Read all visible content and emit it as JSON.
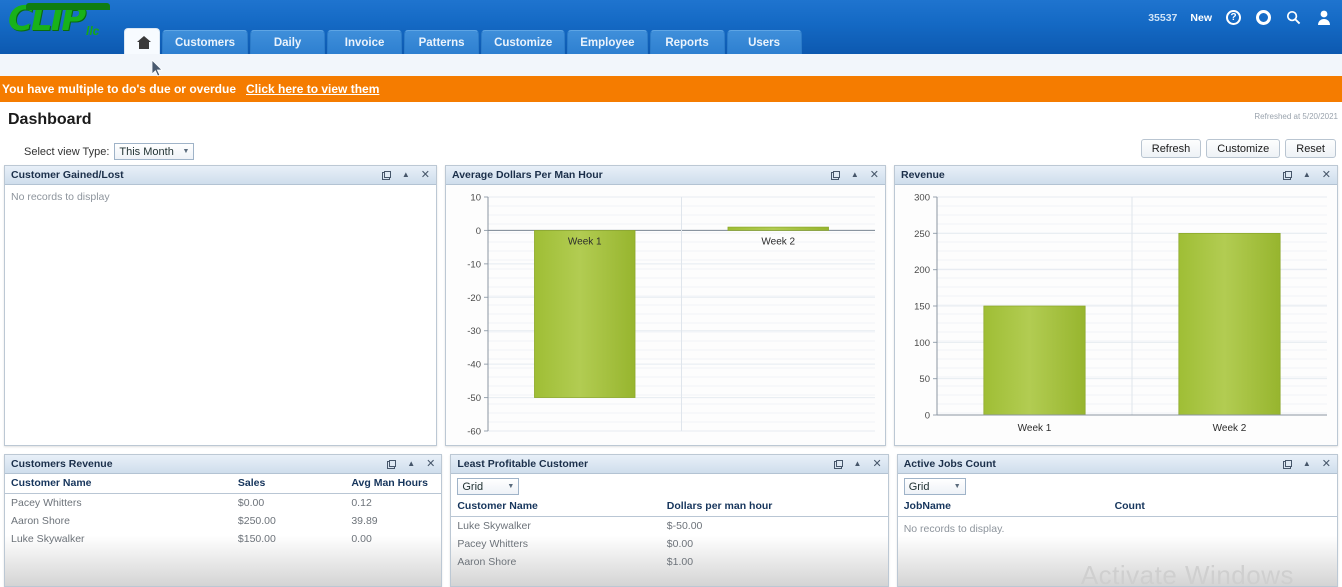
{
  "topbar": {
    "logo_text": "CLIP",
    "logo_sub": "llc",
    "tabs": [
      {
        "label": "",
        "name": "home",
        "icon": "home-icon",
        "active": true
      },
      {
        "label": "Customers",
        "name": "customers"
      },
      {
        "label": "Daily",
        "name": "daily"
      },
      {
        "label": "Invoice",
        "name": "invoice"
      },
      {
        "label": "Patterns",
        "name": "patterns"
      },
      {
        "label": "Customize",
        "name": "customize"
      },
      {
        "label": "Employee",
        "name": "employee"
      },
      {
        "label": "Reports",
        "name": "reports"
      },
      {
        "label": "Users",
        "name": "users"
      }
    ],
    "account_number": "35537",
    "new_label": "New",
    "icons": [
      "help-icon",
      "settings-icon",
      "search-icon",
      "user-icon"
    ]
  },
  "alert": {
    "message": "You have multiple to do's due or overdue",
    "link": "Click here to view them",
    "color": "#f57c00"
  },
  "page": {
    "title": "Dashboard",
    "refreshed": "Refreshed at 5/20/2021",
    "view_type_label": "Select view Type:",
    "view_type_value": "This Month",
    "buttons": {
      "refresh": "Refresh",
      "customize": "Customize",
      "reset": "Reset"
    },
    "watermark": "Activate Windows"
  },
  "panels": {
    "customer_gained_lost": {
      "title": "Customer Gained/Lost",
      "empty": "No records to display"
    },
    "avg_dollars": {
      "title": "Average Dollars Per Man Hour"
    },
    "revenue": {
      "title": "Revenue"
    },
    "customers_revenue": {
      "title": "Customers Revenue",
      "columns": [
        "Customer Name",
        "Sales",
        "Avg Man Hours"
      ],
      "rows": [
        [
          "Pacey Whitters",
          "$0.00",
          "0.12"
        ],
        [
          "Aaron Shore",
          "$250.00",
          "39.89"
        ],
        [
          "Luke Skywalker",
          "$150.00",
          "0.00"
        ]
      ]
    },
    "least_profitable": {
      "title": "Least Profitable Customer",
      "view_selector": "Grid",
      "columns": [
        "Customer Name",
        "Dollars per man hour"
      ],
      "rows": [
        [
          "Luke Skywalker",
          "$-50.00"
        ],
        [
          "Pacey Whitters",
          "$0.00"
        ],
        [
          "Aaron Shore",
          "$1.00"
        ]
      ]
    },
    "active_jobs": {
      "title": "Active Jobs Count",
      "view_selector": "Grid",
      "columns": [
        "JobName",
        "Count"
      ],
      "empty": "No records to display."
    }
  },
  "chart_data": [
    {
      "type": "bar",
      "title": "Average Dollars Per Man Hour",
      "categories": [
        "Week 1",
        "Week 2"
      ],
      "values": [
        -50,
        1
      ],
      "xlabel": "",
      "ylabel": "",
      "ylim": [
        -60,
        10
      ],
      "yticks": [
        10,
        0,
        -10,
        -20,
        -30,
        -40,
        -50,
        -60
      ],
      "grid": true,
      "legend": "none",
      "bar_color": "#a2c037",
      "label_position": "inside-top"
    },
    {
      "type": "bar",
      "title": "Revenue",
      "categories": [
        "Week 1",
        "Week 2"
      ],
      "values": [
        150,
        250
      ],
      "xlabel": "",
      "ylabel": "",
      "ylim": [
        0,
        300
      ],
      "yticks": [
        300,
        250,
        200,
        150,
        100,
        50,
        0
      ],
      "grid": true,
      "legend": "none",
      "bar_color": "#a2c037",
      "label_position": "below-axis"
    }
  ]
}
